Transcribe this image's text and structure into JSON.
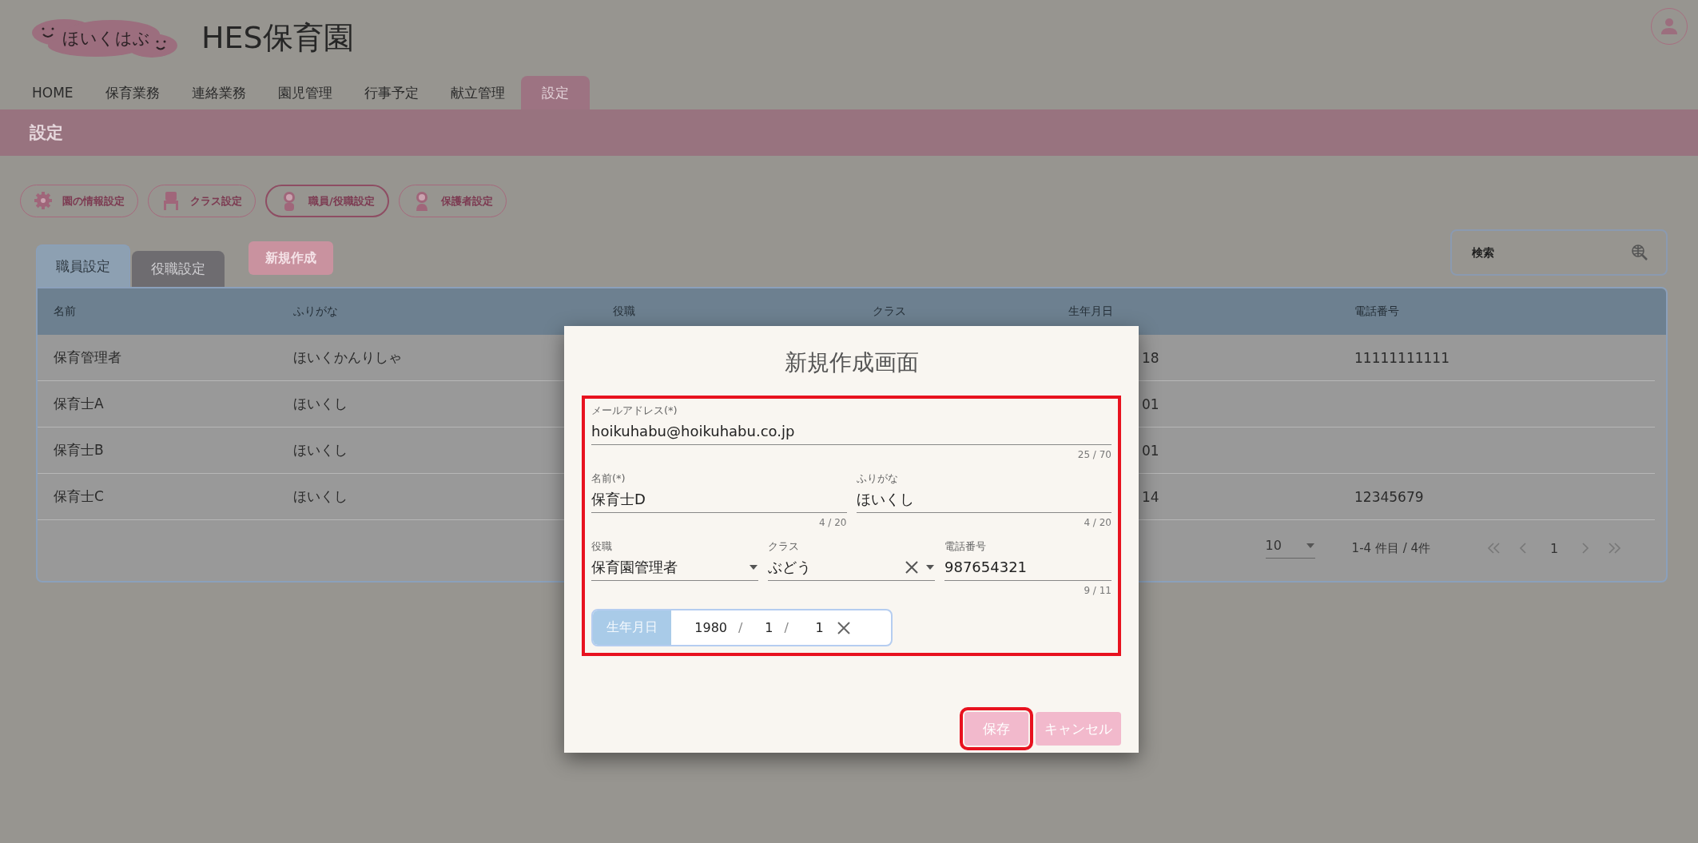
{
  "logo": {
    "text": "ほいくはぶ"
  },
  "site_title": "HES保育園",
  "nav": [
    {
      "label": "HOME",
      "selected": false
    },
    {
      "label": "保育業務",
      "selected": false
    },
    {
      "label": "連絡業務",
      "selected": false
    },
    {
      "label": "園児管理",
      "selected": false
    },
    {
      "label": "行事予定",
      "selected": false
    },
    {
      "label": "献立管理",
      "selected": false
    },
    {
      "label": "設定",
      "selected": true
    }
  ],
  "page_title": "設定",
  "settings_buttons": [
    {
      "label": "園の情報設定",
      "kind": "gear",
      "selected": false
    },
    {
      "label": "クラス設定",
      "kind": "chair",
      "selected": false
    },
    {
      "label": "職員/役職設定",
      "kind": "staff",
      "selected": true
    },
    {
      "label": "保護者設定",
      "kind": "parent",
      "selected": false
    }
  ],
  "tabs": [
    {
      "label": "職員設定",
      "selected": true
    },
    {
      "label": "役職設定",
      "selected": false
    }
  ],
  "new_button": "新規作成",
  "search": {
    "placeholder": "検索"
  },
  "table": {
    "columns": [
      "名前",
      "ふりがな",
      "役職",
      "クラス",
      "生年月日",
      "電話番号"
    ],
    "rows": [
      {
        "name": "保育管理者",
        "furigana": "ほいくかんりしゃ",
        "birth_date": "18",
        "phone": "11111111111"
      },
      {
        "name": "保育士A",
        "furigana": "ほいくし",
        "birth_date": "01"
      },
      {
        "name": "保育士B",
        "furigana": "ほいくし",
        "birth_date": "01"
      },
      {
        "name": "保育士C",
        "furigana": "ほいくし",
        "birth_date": "14",
        "phone": "12345679"
      }
    ]
  },
  "pagination": {
    "page_size": "10",
    "range": "1-4 件目 / 4件",
    "page": "1"
  },
  "dialog": {
    "title": "新規作成画面",
    "form_highlighted": true,
    "email": {
      "label": "メールアドレス(*)",
      "value": "hoikuhabu@hoikuhabu.co.jp",
      "counter": "25 / 70"
    },
    "name": {
      "label": "名前(*)",
      "value": "保育士D",
      "counter": "4 / 20"
    },
    "furigana": {
      "label": "ふりがな",
      "value": "ほいくし",
      "counter": "4 / 20"
    },
    "role": {
      "label": "役職",
      "value": "保育園管理者",
      "clearable": false
    },
    "class": {
      "label": "クラス",
      "value": "ぶどう",
      "clearable": true
    },
    "phone": {
      "label": "電話番号",
      "value": "987654321",
      "counter": "9 / 11"
    },
    "date": {
      "label": "生年月日",
      "year": "1980",
      "month": "1",
      "day": "1",
      "separator": "/"
    },
    "buttons": [
      {
        "label": "保存",
        "kind": "save",
        "highlighted": true
      },
      {
        "label": "キャンセル",
        "kind": "cancel",
        "highlighted": false
      }
    ]
  }
}
